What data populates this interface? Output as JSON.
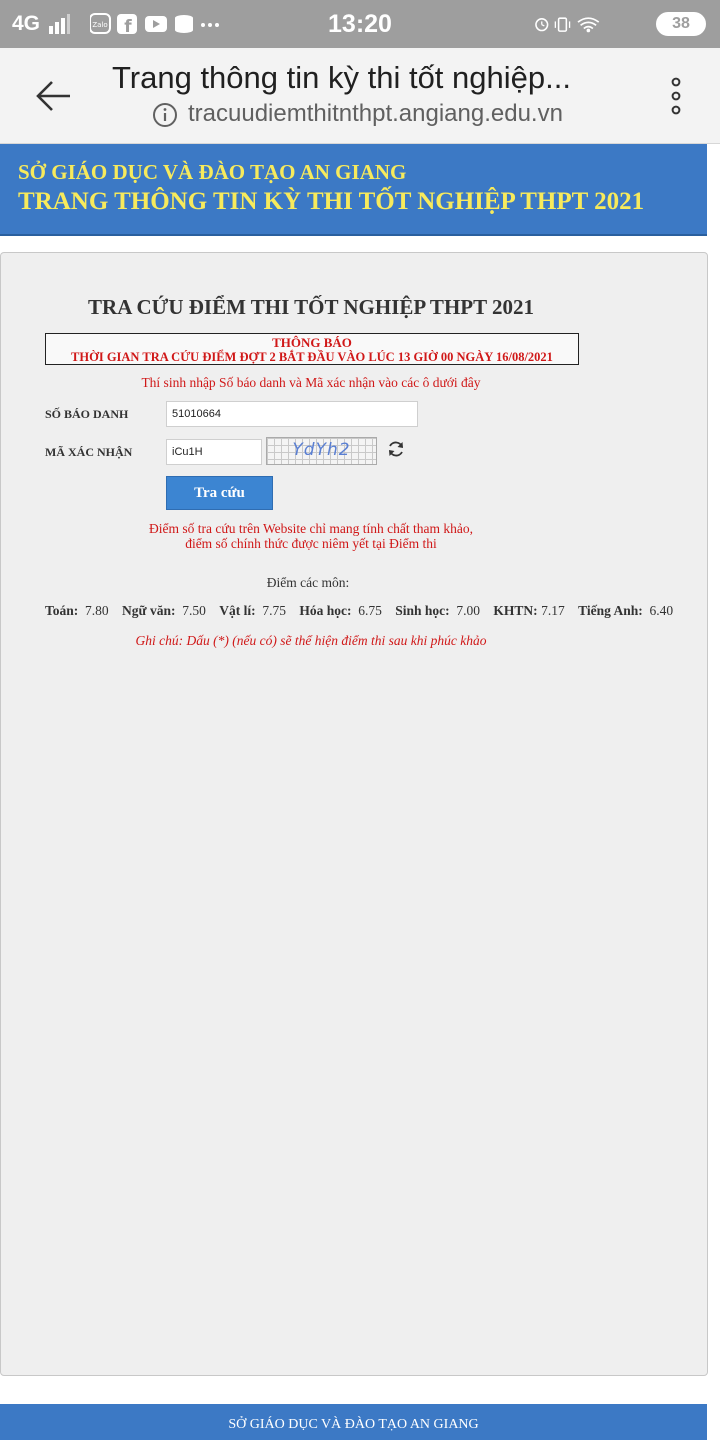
{
  "status_bar": {
    "network": "4G",
    "time": "13:20",
    "battery": "38",
    "icons": [
      "signal-bars-icon",
      "zalo-icon",
      "facebook-icon",
      "youtube-icon",
      "data-saver-icon",
      "more-notifications-icon",
      "alarm-icon",
      "vibrate-icon",
      "wifi-icon",
      "battery-icon"
    ]
  },
  "browser": {
    "page_title": "Trang thông tin kỳ thi tốt nghiệp...",
    "url": "tracuudiemthitnthpt.angiang.edu.vn"
  },
  "header": {
    "line1": "SỞ GIÁO DỤC VÀ ĐÀO TẠO AN GIANG",
    "line2": "TRANG THÔNG TIN KỲ THI TỐT NGHIỆP THPT 2021"
  },
  "main": {
    "title": "TRA CỨU ĐIỂM THI TỐT NGHIỆP THPT 2021",
    "notice_title": "THÔNG BÁO",
    "notice_text": "THỜI GIAN TRA CỨU ĐIỂM ĐỢT 2 BẮT ĐẦU VÀO LÚC 13 GIỜ 00 NGÀY 16/08/2021",
    "instruction": "Thí sinh nhập Số báo danh và Mã xác nhận vào các ô dưới đây",
    "sbd_label": "SỐ BÁO DANH",
    "sbd_value": "51010664",
    "code_label": "MÃ XÁC NHẬN",
    "code_value": "iCu1H",
    "captcha_text": "YdYh2",
    "search_button": "Tra cứu",
    "disclaimer_line1": "Điểm số tra cứu trên Website chỉ mang tính chất tham khảo,",
    "disclaimer_line2": "điểm số chính thức được niêm yết tại Điểm thi",
    "scores_label": "Điểm các môn:",
    "scores": [
      {
        "subject": "Toán:",
        "score": "7.80"
      },
      {
        "subject": "Ngữ văn:",
        "score": "7.50"
      },
      {
        "subject": "Vật lí:",
        "score": "7.75"
      },
      {
        "subject": "Hóa học:",
        "score": "6.75"
      },
      {
        "subject": "Sinh học:",
        "score": "7.00"
      },
      {
        "subject": "KHTN:",
        "score": "7.17"
      },
      {
        "subject": "Tiếng Anh:",
        "score": "6.40"
      }
    ],
    "note": "Ghi chú: Dấu (*) (nếu có) sẽ thể hiện điểm thi sau khi phúc khảo"
  },
  "footer": {
    "text": "SỞ GIÁO DỤC VÀ ĐÀO TẠO AN GIANG"
  }
}
